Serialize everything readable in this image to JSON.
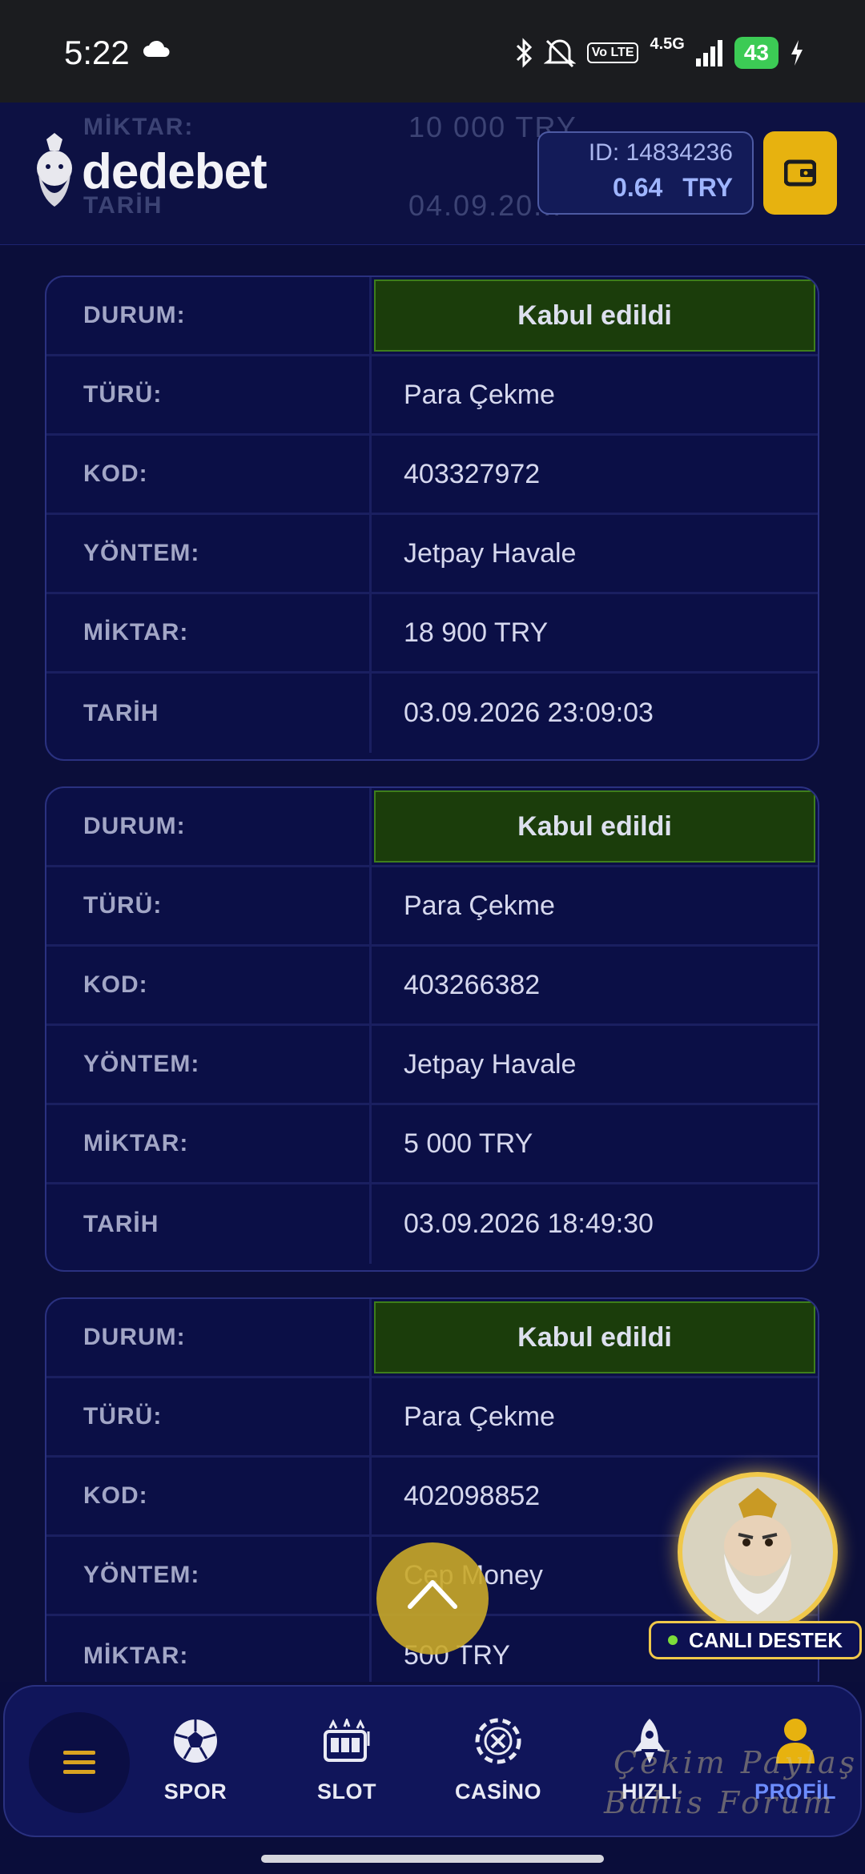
{
  "status_bar": {
    "time": "5:22",
    "network": "4.5G",
    "volte": "Vo LTE",
    "battery": "43",
    "icons": [
      "cloud-icon",
      "bluetooth-icon",
      "mute-icon",
      "volte-icon",
      "signal-icon",
      "battery-icon",
      "charging-icon"
    ]
  },
  "header": {
    "brand": "dedebet",
    "user_id": "ID: 14834236",
    "balance": "0.64",
    "currency": "TRY",
    "ghost_row_1_label": "MİKTAR:",
    "ghost_row_1_value": "10 000 TRY",
    "ghost_row_2_label": "TARİH",
    "ghost_row_2_value": "04.09.20..."
  },
  "labels": {
    "status": "DURUM:",
    "type": "TÜRÜ:",
    "code": "KOD:",
    "method": "YÖNTEM:",
    "amount": "MİKTAR:",
    "date": "TARİH"
  },
  "transactions": [
    {
      "status": "Kabul edildi",
      "type": "Para Çekme",
      "code": "403327972",
      "method": "Jetpay Havale",
      "amount": "18 900 TRY",
      "date": "03.09.2026 23:09:03"
    },
    {
      "status": "Kabul edildi",
      "type": "Para Çekme",
      "code": "403266382",
      "method": "Jetpay Havale",
      "amount": "5 000 TRY",
      "date": "03.09.2026 18:49:30"
    },
    {
      "status": "Kabul edildi",
      "type": "Para Çekme",
      "code": "402098852",
      "method": "Cep Money",
      "amount": "500 TRY",
      "date": ""
    }
  ],
  "support": {
    "label": "CANLI DESTEK"
  },
  "nav": {
    "items": [
      {
        "label": "SPOR",
        "icon": "soccer-ball-icon"
      },
      {
        "label": "SLOT",
        "icon": "slot-machine-icon"
      },
      {
        "label": "CASİNO",
        "icon": "casino-chip-icon"
      },
      {
        "label": "HIZLI",
        "icon": "rocket-icon"
      },
      {
        "label": "PROFİL",
        "icon": "profile-icon"
      }
    ],
    "active": "PROFİL"
  },
  "watermark": {
    "line1": "Çekim Paylaş",
    "line2": "Bahis Forum"
  },
  "colors": {
    "accent": "#e7b20f",
    "status_green": "#1b3d0b",
    "background": "#0b0e3a",
    "active_nav": "#6d8dff"
  }
}
